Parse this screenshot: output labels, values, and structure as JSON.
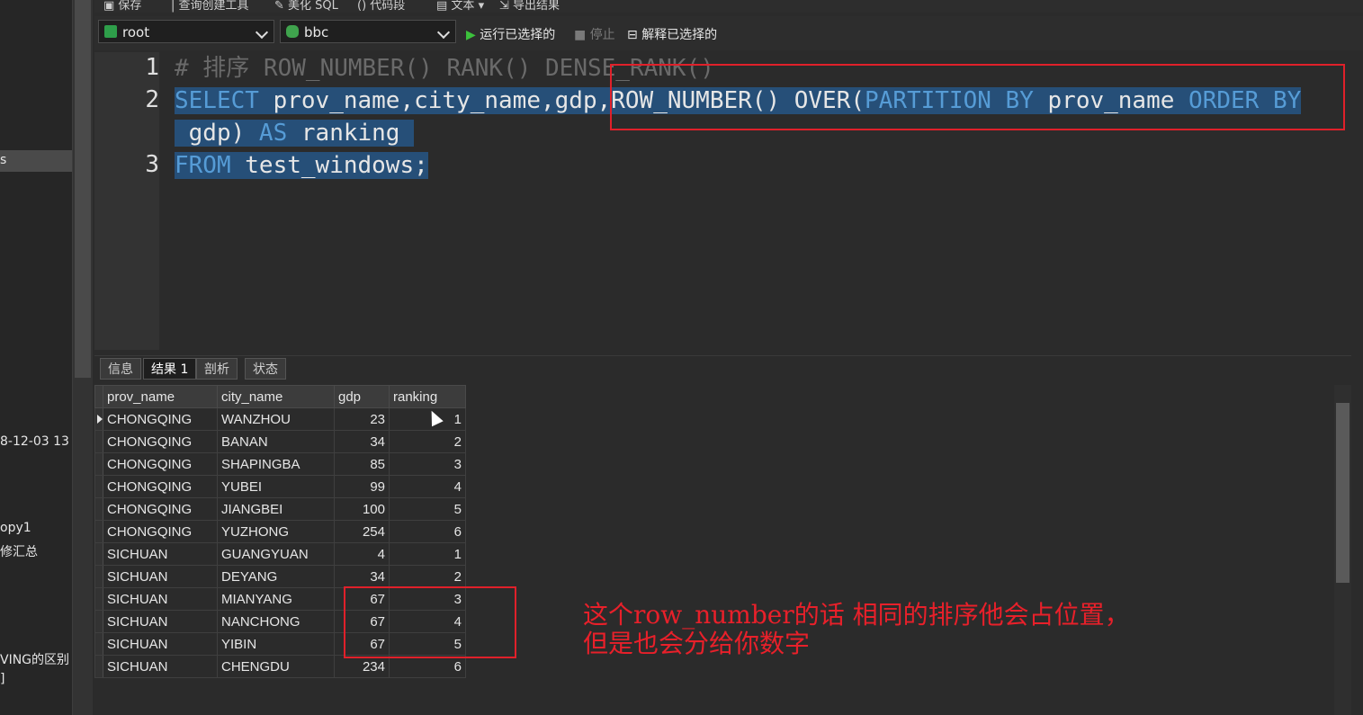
{
  "sidebar": {
    "items": [
      "s",
      "8-12-03 13",
      "opy1",
      "修汇总",
      "VING的区别",
      "]"
    ]
  },
  "toolbar": {
    "top_items": [
      "保存",
      "查询创建工具",
      "美化 SQL",
      "代码段",
      "文本",
      "导出结果"
    ],
    "connection": "root",
    "database": "bbc",
    "run_selected": "运行已选择的",
    "stop": "停止",
    "explain_selected": "解释已选择的"
  },
  "editor": {
    "line_numbers": [
      "1",
      "2",
      "3"
    ],
    "line1": "# 排序 ROW_NUMBER() RANK() DENSE_RANK()",
    "line2_kw1": "SELECT",
    "line2_t1": " prov_name,city_name,gdp,ROW_NUMBER() OVER(",
    "line2_kw2": "PARTITION BY",
    "line2_t2": " prov_name ",
    "line2_kw3": "ORDER BY",
    "line2b_t1": " gdp) ",
    "line2b_kw": "AS",
    "line2b_t2": " ranking ",
    "line3_kw": "FROM",
    "line3_t": " test_windows;"
  },
  "tabs": [
    "信息",
    "结果 1",
    "剖析",
    "状态"
  ],
  "grid": {
    "columns": [
      "prov_name",
      "city_name",
      "gdp",
      "ranking"
    ],
    "rows": [
      [
        "CHONGQING",
        "WANZHOU",
        "23",
        "1"
      ],
      [
        "CHONGQING",
        "BANAN",
        "34",
        "2"
      ],
      [
        "CHONGQING",
        "SHAPINGBA",
        "85",
        "3"
      ],
      [
        "CHONGQING",
        "YUBEI",
        "99",
        "4"
      ],
      [
        "CHONGQING",
        "JIANGBEI",
        "100",
        "5"
      ],
      [
        "CHONGQING",
        "YUZHONG",
        "254",
        "6"
      ],
      [
        "SICHUAN",
        "GUANGYUAN",
        "4",
        "1"
      ],
      [
        "SICHUAN",
        "DEYANG",
        "34",
        "2"
      ],
      [
        "SICHUAN",
        "MIANYANG",
        "67",
        "3"
      ],
      [
        "SICHUAN",
        "NANCHONG",
        "67",
        "4"
      ],
      [
        "SICHUAN",
        "YIBIN",
        "67",
        "5"
      ],
      [
        "SICHUAN",
        "CHENGDU",
        "234",
        "6"
      ]
    ]
  },
  "annotation": {
    "line1": "这个row_number的话 相同的排序他会占位置，",
    "line2": "但是也会分给你数字"
  },
  "colors": {
    "highlight": "#e0202a",
    "keyword": "#569cd6",
    "selection": "#264f78"
  }
}
